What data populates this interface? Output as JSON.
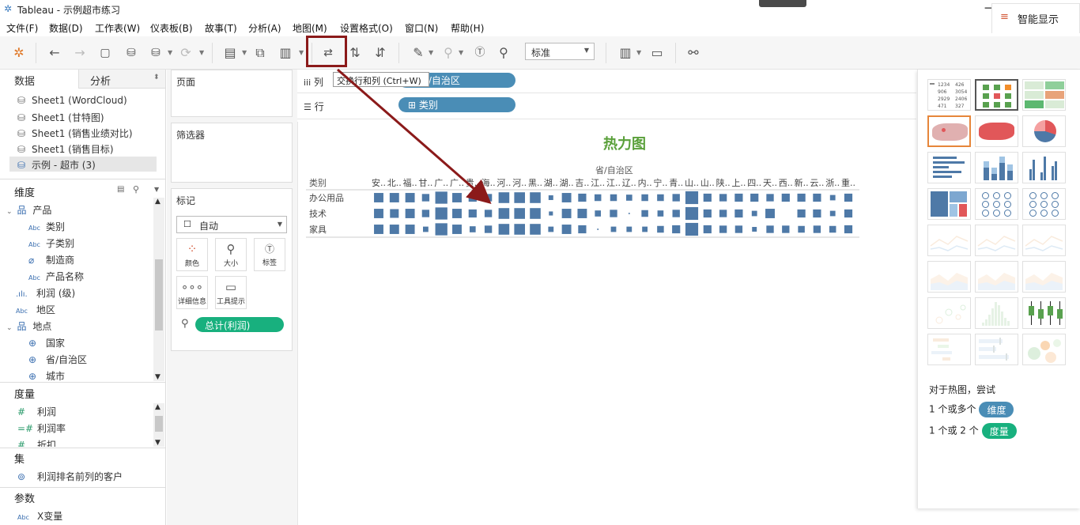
{
  "window": {
    "title": "Tableau - 示例超市练习"
  },
  "menu": [
    "文件(F)",
    "数据(D)",
    "工作表(W)",
    "仪表板(B)",
    "故事(T)",
    "分析(A)",
    "地图(M)",
    "设置格式(O)",
    "窗口(N)",
    "帮助(H)"
  ],
  "toolbar": {
    "fit_value": "标准",
    "showme_label": "智能显示",
    "tooltip": "交换行和列 (Ctrl+W)"
  },
  "left_panel": {
    "tabs": [
      "数据",
      "分析"
    ],
    "sources": [
      "Sheet1 (WordCloud)",
      "Sheet1 (甘特图)",
      "Sheet1 (销售业绩对比)",
      "Sheet1 (销售目标)",
      "示例 - 超市 (3)"
    ],
    "dimensions_header": "维度",
    "dimensions": [
      {
        "label": "产品",
        "type": "folder",
        "level": 0
      },
      {
        "label": "类别",
        "type": "Abc",
        "level": 1
      },
      {
        "label": "子类别",
        "type": "Abc",
        "level": 1
      },
      {
        "label": "制造商",
        "type": "clip",
        "level": 1
      },
      {
        "label": "产品名称",
        "type": "Abc",
        "level": 1
      },
      {
        "label": "利润 (级)",
        "type": "bin",
        "level": 0
      },
      {
        "label": "地区",
        "type": "Abc",
        "level": 0
      },
      {
        "label": "地点",
        "type": "folder",
        "level": 0
      },
      {
        "label": "国家",
        "type": "globe",
        "level": 1
      },
      {
        "label": "省/自治区",
        "type": "globe",
        "level": 1
      },
      {
        "label": "城市",
        "type": "globe",
        "level": 1
      }
    ],
    "measures_header": "度量",
    "measures": [
      "利润",
      "利润率",
      "折扣"
    ],
    "sets_header": "集",
    "sets": [
      "利润排名前列的客户"
    ],
    "params_header": "参数",
    "params": [
      "X变量"
    ]
  },
  "shelves": {
    "pages_label": "页面",
    "filters_label": "筛选器",
    "marks_label": "标记",
    "mark_type": "自动",
    "mark_buttons": [
      "颜色",
      "大小",
      "标签",
      "详细信息",
      "工具提示"
    ],
    "size_field": "总计(利润)",
    "columns_label": "列",
    "rows_label": "行",
    "columns_pill": "省/自治区",
    "rows_pill": "类别"
  },
  "chart_data": {
    "type": "heatmap",
    "title": "热力图",
    "column_header": "省/自治区",
    "row_header": "类别",
    "rows": [
      "办公用品",
      "技术",
      "家具"
    ],
    "columns": [
      "安..",
      "北..",
      "福..",
      "甘..",
      "广..",
      "广..",
      "贵..",
      "海..",
      "河..",
      "河..",
      "黑..",
      "湖..",
      "湖..",
      "吉..",
      "江..",
      "江..",
      "辽..",
      "内..",
      "宁..",
      "青..",
      "山..",
      "山..",
      "陕..",
      "上..",
      "四..",
      "天..",
      "西..",
      "新..",
      "云..",
      "浙..",
      "重.."
    ],
    "values": [
      [
        0.7,
        0.7,
        0.7,
        0.55,
        0.9,
        0.7,
        0.6,
        0.55,
        0.8,
        0.8,
        0.8,
        0.35,
        0.7,
        0.6,
        0.5,
        0.5,
        0.45,
        0.5,
        0.5,
        0.55,
        0.95,
        0.6,
        0.55,
        0.6,
        0.6,
        0.55,
        0.6,
        0.6,
        0.6,
        0.4,
        0.6
      ],
      [
        0.7,
        0.65,
        0.7,
        0.55,
        0.9,
        0.7,
        0.6,
        0.55,
        0.8,
        0.8,
        0.8,
        0.3,
        0.7,
        0.7,
        0.45,
        0.55,
        0.1,
        0.5,
        0.45,
        0.55,
        0.95,
        0.6,
        0.55,
        0.6,
        0.4,
        0.7,
        0.0,
        0.6,
        0.6,
        0.4,
        0.6
      ],
      [
        0.7,
        0.7,
        0.7,
        0.4,
        0.9,
        0.7,
        0.45,
        0.55,
        0.8,
        0.8,
        0.8,
        0.4,
        0.7,
        0.6,
        0.1,
        0.4,
        0.4,
        0.4,
        0.5,
        0.6,
        0.95,
        0.6,
        0.55,
        0.55,
        0.35,
        0.55,
        0.55,
        0.5,
        0.55,
        0.5,
        0.6
      ]
    ],
    "color": "#4e79a7"
  },
  "showme": {
    "hint_title": "对于热图，尝试",
    "hint_dim_prefix": "1 个或多个",
    "hint_dim_pill": "维度",
    "hint_mea_prefix": "1 个或 2 个",
    "hint_mea_pill": "度量",
    "thumb_text_cells": [
      "1234",
      "426",
      "906",
      "3054",
      "2929",
      "2406",
      "471",
      "327"
    ]
  }
}
